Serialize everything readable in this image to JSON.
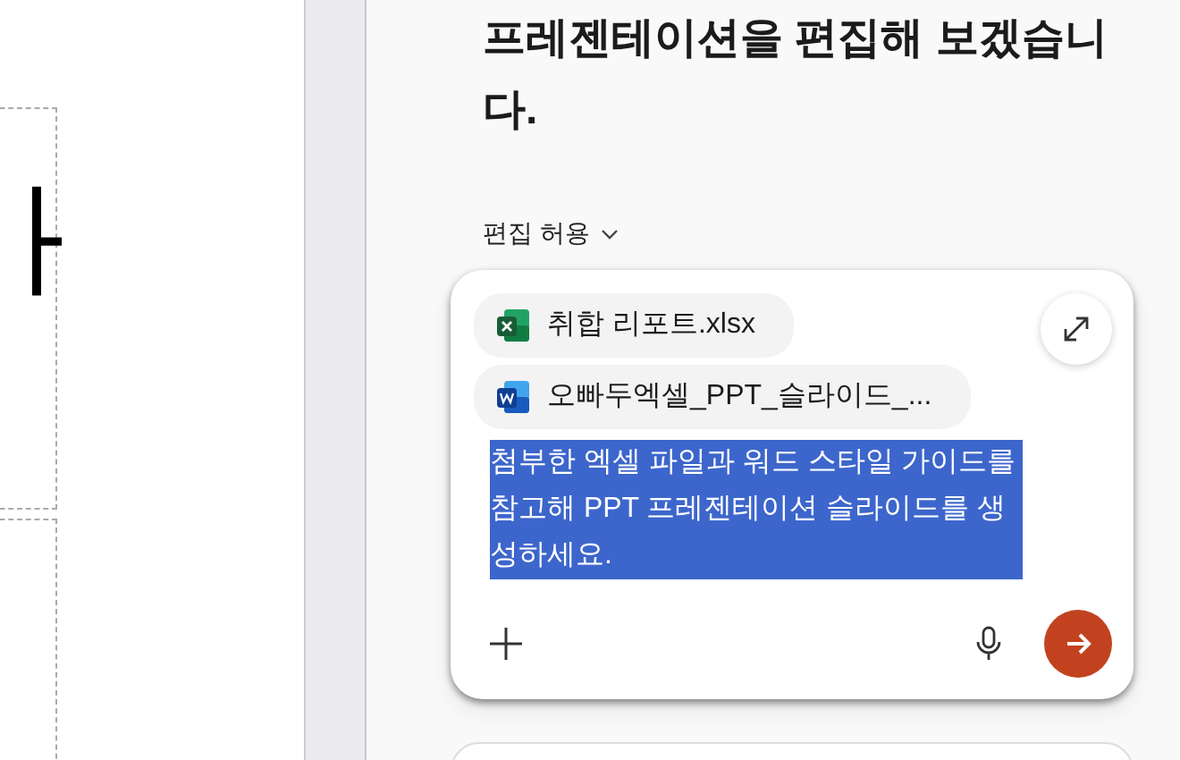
{
  "slide": {
    "glyph": "ㅏ"
  },
  "heading": "프레젠테이션을 편집해 보겠습니다.",
  "permission": {
    "label": "편집 허용"
  },
  "composer": {
    "attachments": [
      {
        "kind": "excel",
        "name": "취합 리포트.xlsx"
      },
      {
        "kind": "word",
        "name": "오빠두엑셀_PPT_슬라이드_..."
      }
    ],
    "prompt": {
      "text": "첨부한 엑셀 파일과 워드 스타일 가이드를 참고해 PPT 프레젠테이션 슬라이드를 생성하세요.",
      "selected": true
    }
  }
}
